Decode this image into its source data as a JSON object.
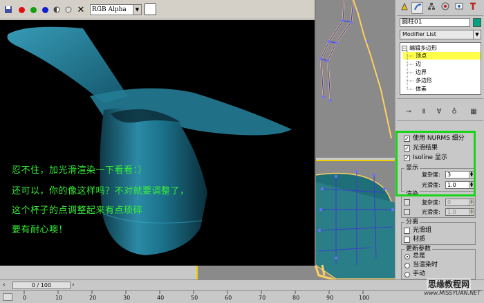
{
  "render_window": {
    "toolbar": {
      "channel_value": "RGB Alpha",
      "dropdown_arrow": "▼",
      "close_glyph": "✕",
      "icons": [
        "save-icon",
        "copy-icon",
        "red-channel-icon",
        "green-channel-icon",
        "blue-channel-icon",
        "alpha-channel-icon",
        "monochrome-icon",
        "clear-icon"
      ],
      "colors": {
        "red": "#e01010",
        "green": "#10a010",
        "blue": "#1020d0"
      }
    },
    "captions": [
      "忍不住，加光滑渲染一下看看：）",
      "还可以，你的像这样吗？不对就要调整了，",
      "这个杯子的点调整起来有点琐碎",
      "要有耐心噢！"
    ],
    "caption_color": "#35ef35",
    "cup_color": "#2b8aa6"
  },
  "command_panel": {
    "tabs": [
      "create-icon",
      "modify-icon",
      "hierarchy-icon",
      "motion-icon",
      "display-icon",
      "utilities-icon"
    ],
    "object_name": "圆柱01",
    "object_color": "#00a080",
    "modifier_list": "Modifier List",
    "stack": {
      "root": "编辑多边形",
      "items": [
        "顶点",
        "边",
        "边界",
        "多边形",
        "体素"
      ],
      "selected": "顶点"
    },
    "subdivision": {
      "use_nurms": "使用 NURMS 细分",
      "smooth_result": "光滑结果",
      "isoline": "Isoline 显示",
      "display_group": "显示",
      "iterations_label": "复杂度:",
      "iterations_value": "3",
      "smoothness_label": "光滑度:",
      "smoothness_value": "1.0",
      "render_group": "渲染",
      "render_iterations_value": "0",
      "render_smoothness_value": "1.0",
      "separate_group": "分离",
      "smoothing_groups": "光滑组",
      "materials": "材质",
      "update_group": "更新参数",
      "update_always": "总是",
      "update_render": "当渲染时",
      "update_manual": "手动"
    },
    "highlight_color": "#16d416"
  },
  "timeline": {
    "slider": "0 / 100",
    "ticks": [
      "0",
      "10",
      "20",
      "30",
      "40",
      "50",
      "60",
      "70",
      "80",
      "90",
      "100"
    ]
  },
  "watermark": {
    "logo": "思缘教程网",
    "url": "www.MISSYUAN.NET"
  }
}
